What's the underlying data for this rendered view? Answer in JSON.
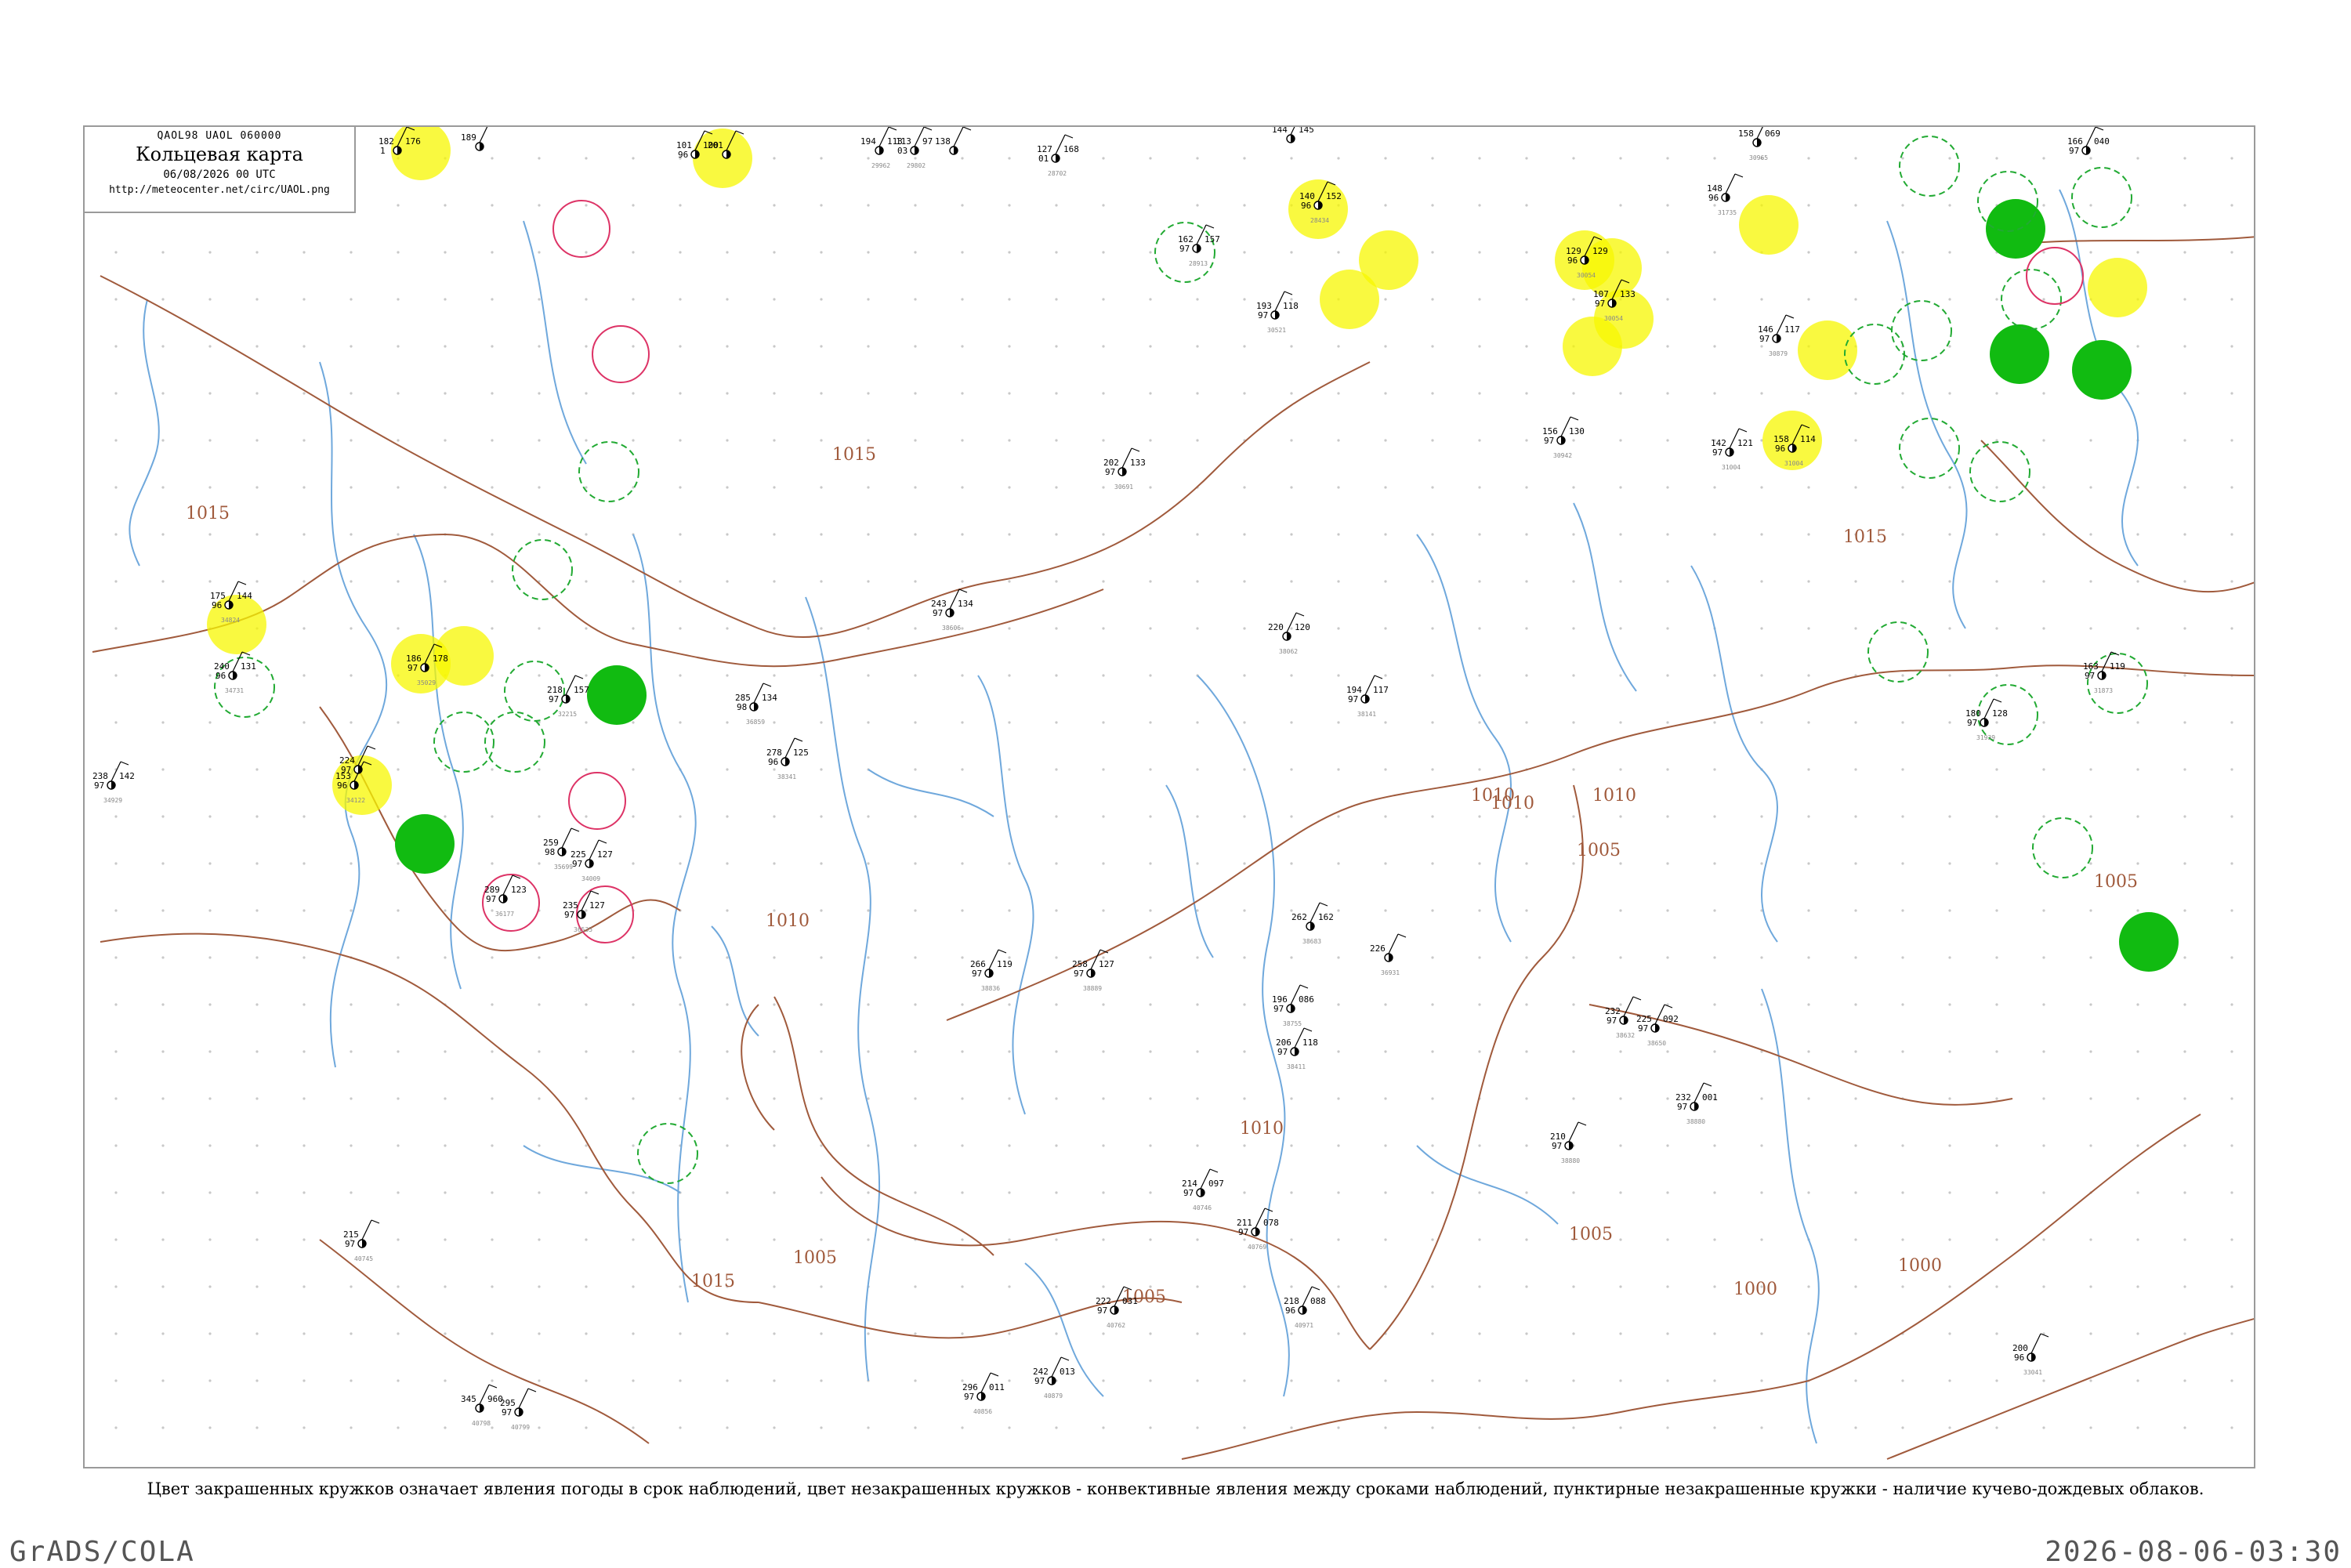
{
  "title_box": {
    "codes": "QAOL98  UAOL  060000",
    "map_title": "Кольцевая карта",
    "datetime": "06/08/2026 00 UTC",
    "url": "http://meteocenter.net/circ/UAOL.png"
  },
  "caption": "Цвет закрашенных кружков означает явления погоды в срок наблюдений, цвет незакрашенных кружков - конвективные явления между сроками наблюдений, пунктирные незакрашенные кружки - наличие кучево-дождевых облаков.",
  "footer": {
    "left": "GrADS/COLA",
    "right": "2026-08-06-03:30"
  },
  "colors": {
    "isobar": "#a05a3c",
    "river": "#6fa8dc",
    "yellow_marker": "#f7f700",
    "green_marker": "#11bb11",
    "green_ring": "#22aa33",
    "pink_ring": "#dd3366",
    "frame": "#9a9a9a"
  },
  "isobar_labels": [
    "1015",
    "1015",
    "1015",
    "1015",
    "1010",
    "1010",
    "1010",
    "1010",
    "1010",
    "1005",
    "1005",
    "1005",
    "1005",
    "1005",
    "1000",
    "1000"
  ],
  "stations": [
    {
      "p": "182",
      "t": "176",
      "tr": "1",
      "g": ""
    },
    {
      "p": "189",
      "t": "",
      "tr": "",
      "g": ""
    },
    {
      "p": "101",
      "t": "100",
      "tr": "96",
      "g": ""
    },
    {
      "p": "201",
      "t": "",
      "tr": "",
      "g": ""
    },
    {
      "p": "194",
      "t": "113",
      "tr": "",
      "g": "29962"
    },
    {
      "p": "113",
      "t": "97",
      "tr": "03",
      "g": "29802"
    },
    {
      "p": "138",
      "t": "",
      "tr": "",
      "g": ""
    },
    {
      "p": "127",
      "t": "168",
      "tr": "01",
      "g": "28702"
    },
    {
      "p": "144",
      "t": "145",
      "tr": "",
      "g": ""
    },
    {
      "p": "140",
      "t": "152",
      "tr": "96",
      "g": "28434"
    },
    {
      "p": "162",
      "t": "157",
      "tr": "97",
      "g": "28913"
    },
    {
      "p": "193",
      "t": "118",
      "tr": "97",
      "g": "30521"
    },
    {
      "p": "129",
      "t": "129",
      "tr": "96",
      "g": "30054"
    },
    {
      "p": "107",
      "t": "133",
      "tr": "97",
      "g": "30054"
    },
    {
      "p": "158",
      "t": "069",
      "tr": "",
      "g": "30965"
    },
    {
      "p": "166",
      "t": "040",
      "tr": "97",
      "g": ""
    },
    {
      "p": "148",
      "t": "",
      "tr": "96",
      "g": "31735"
    },
    {
      "p": "142",
      "t": "121",
      "tr": "97",
      "g": "31004"
    },
    {
      "p": "158",
      "t": "114",
      "tr": "96",
      "g": "31004"
    },
    {
      "p": "146",
      "t": "117",
      "tr": "97",
      "g": "30879"
    },
    {
      "p": "163",
      "t": "119",
      "tr": "97",
      "g": "31873"
    },
    {
      "p": "180",
      "t": "128",
      "tr": "97",
      "g": "31939"
    },
    {
      "p": "218",
      "t": "157",
      "tr": "97",
      "g": "32215"
    },
    {
      "p": "225",
      "t": "127",
      "tr": "97",
      "g": "34009"
    },
    {
      "p": "224",
      "t": "",
      "tr": "97",
      "g": ""
    },
    {
      "p": "153",
      "t": "",
      "tr": "96",
      "g": "34122"
    },
    {
      "p": "186",
      "t": "178",
      "tr": "97",
      "g": "35029"
    },
    {
      "p": "175",
      "t": "144",
      "tr": "96",
      "g": "34824"
    },
    {
      "p": "240",
      "t": "131",
      "tr": "96",
      "g": "34731"
    },
    {
      "p": "238",
      "t": "142",
      "tr": "97",
      "g": "34929"
    },
    {
      "p": "259",
      "t": "",
      "tr": "98",
      "g": "35699"
    },
    {
      "p": "289",
      "t": "123",
      "tr": "97",
      "g": "36177"
    },
    {
      "p": "235",
      "t": "127",
      "tr": "97",
      "g": "36535"
    },
    {
      "p": "285",
      "t": "134",
      "tr": "98",
      "g": "36859"
    },
    {
      "p": "278",
      "t": "125",
      "tr": "96",
      "g": "38341"
    },
    {
      "p": "243",
      "t": "134",
      "tr": "97",
      "g": "38606"
    },
    {
      "p": "220",
      "t": "120",
      "tr": "",
      "g": "38062"
    },
    {
      "p": "194",
      "t": "117",
      "tr": "97",
      "g": "38141"
    },
    {
      "p": "266",
      "t": "119",
      "tr": "97",
      "g": "38836"
    },
    {
      "p": "258",
      "t": "127",
      "tr": "97",
      "g": "38889"
    },
    {
      "p": "262",
      "t": "162",
      "tr": "",
      "g": "38683"
    },
    {
      "p": "196",
      "t": "086",
      "tr": "97",
      "g": "38755"
    },
    {
      "p": "226",
      "t": "",
      "tr": "",
      "g": "36931"
    },
    {
      "p": "232",
      "t": "",
      "tr": "97",
      "g": "38632"
    },
    {
      "p": "225",
      "t": "092",
      "tr": "97",
      "g": "38650"
    },
    {
      "p": "210",
      "t": "",
      "tr": "97",
      "g": "38880"
    },
    {
      "p": "232",
      "t": "001",
      "tr": "97",
      "g": "38880"
    },
    {
      "p": "200",
      "t": "",
      "tr": "96",
      "g": "33041"
    },
    {
      "p": "215",
      "t": "",
      "tr": "97",
      "g": "40745"
    },
    {
      "p": "345",
      "t": "960",
      "tr": "",
      "g": "40798"
    },
    {
      "p": "295",
      "t": "",
      "tr": "97",
      "g": "40799"
    },
    {
      "p": "296",
      "t": "011",
      "tr": "97",
      "g": "40856"
    },
    {
      "p": "242",
      "t": "013",
      "tr": "97",
      "g": "40879"
    },
    {
      "p": "222",
      "t": "031",
      "tr": "97",
      "g": "40762"
    },
    {
      "p": "211",
      "t": "078",
      "tr": "97",
      "g": "40769"
    },
    {
      "p": "214",
      "t": "097",
      "tr": "97",
      "g": "40746"
    },
    {
      "p": "218",
      "t": "088",
      "tr": "96",
      "g": "40971"
    },
    {
      "p": "206",
      "t": "118",
      "tr": "97",
      "g": "38411"
    },
    {
      "p": "202",
      "t": "133",
      "tr": "97",
      "g": "30691"
    },
    {
      "p": "156",
      "t": "130",
      "tr": "97",
      "g": "30942"
    }
  ]
}
